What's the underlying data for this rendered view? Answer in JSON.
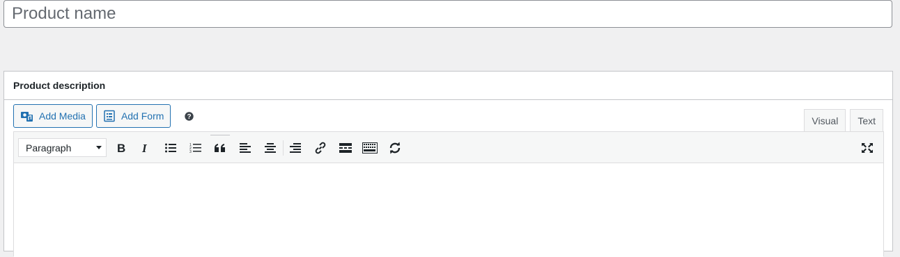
{
  "title_field": {
    "placeholder": "Product name",
    "value": ""
  },
  "description_box": {
    "heading": "Product description",
    "media_buttons": {
      "add_media": "Add Media",
      "add_form": "Add Form"
    },
    "tabs": {
      "visual": "Visual",
      "text": "Text",
      "active": "visual"
    },
    "toolbar": {
      "format_select": "Paragraph",
      "buttons": [
        "bold-icon",
        "italic-icon",
        "bulleted-list-icon",
        "numbered-list-icon",
        "blockquote-icon",
        "align-left-icon",
        "align-center-icon",
        "align-right-icon",
        "link-icon",
        "read-more-icon",
        "toolbar-toggle-icon",
        "refresh-icon",
        "fullscreen-icon"
      ]
    },
    "content": ""
  },
  "colors": {
    "accent": "#2271b1",
    "background": "#f0f0f1",
    "border": "#c3c4c7",
    "text": "#1d2327"
  }
}
